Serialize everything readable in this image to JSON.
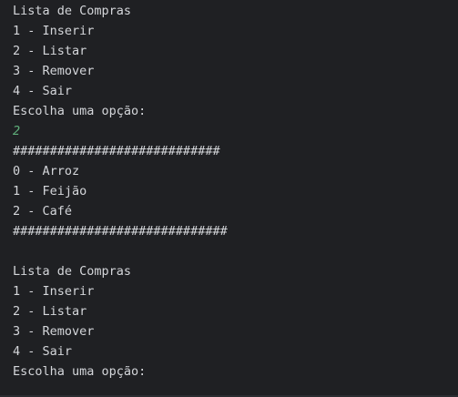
{
  "console": {
    "lines": [
      {
        "text": "Lista de Compras",
        "kind": "output"
      },
      {
        "text": "1 - Inserir",
        "kind": "output"
      },
      {
        "text": "2 - Listar",
        "kind": "output"
      },
      {
        "text": "3 - Remover",
        "kind": "output"
      },
      {
        "text": "4 - Sair",
        "kind": "output"
      },
      {
        "text": "Escolha uma opção:",
        "kind": "output"
      },
      {
        "text": "2",
        "kind": "input"
      },
      {
        "text": "############################",
        "kind": "output"
      },
      {
        "text": "0 - Arroz",
        "kind": "output"
      },
      {
        "text": "1 - Feijão",
        "kind": "output"
      },
      {
        "text": "2 - Café",
        "kind": "output"
      },
      {
        "text": "#############################",
        "kind": "output"
      },
      {
        "text": "",
        "kind": "output"
      },
      {
        "text": "Lista de Compras",
        "kind": "output"
      },
      {
        "text": "1 - Inserir",
        "kind": "output"
      },
      {
        "text": "2 - Listar",
        "kind": "output"
      },
      {
        "text": "3 - Remover",
        "kind": "output"
      },
      {
        "text": "4 - Sair",
        "kind": "output"
      },
      {
        "text": "Escolha uma opção:",
        "kind": "output"
      }
    ]
  },
  "colors": {
    "background": "#1f2023",
    "output_text": "#d4d6da",
    "input_text": "#5fae7a"
  }
}
